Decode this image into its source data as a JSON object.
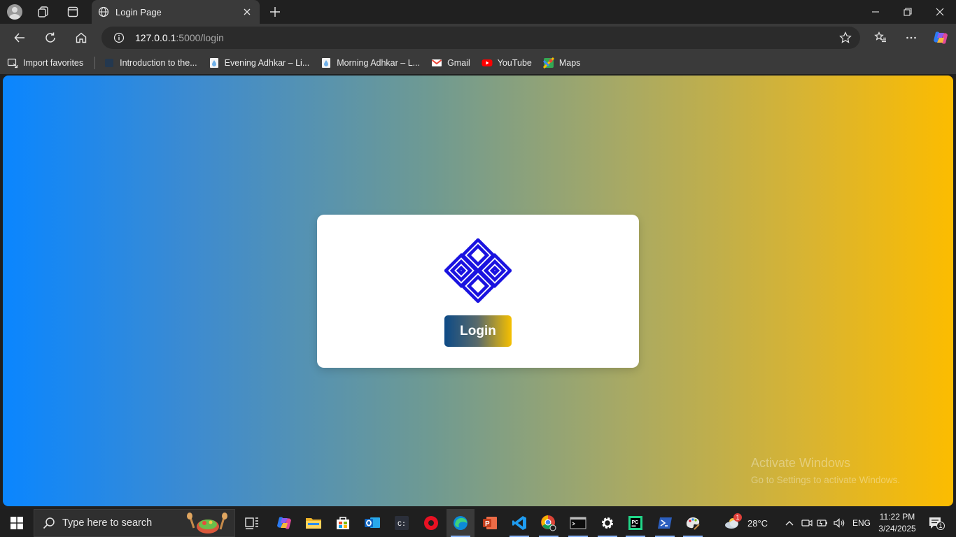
{
  "browser": {
    "tab": {
      "title": "Login Page"
    },
    "address": {
      "host": "127.0.0.1",
      "rest": ":5000/login"
    },
    "favorites": [
      {
        "label": "Import favorites",
        "icon": "import-icon"
      },
      {
        "label": "Introduction to the...",
        "icon": "page-icon"
      },
      {
        "label": "Evening Adhkar – Li...",
        "icon": "drop-icon"
      },
      {
        "label": "Morning Adhkar – L...",
        "icon": "drop-icon"
      },
      {
        "label": "Gmail",
        "icon": "gmail-icon"
      },
      {
        "label": "YouTube",
        "icon": "youtube-icon"
      },
      {
        "label": "Maps",
        "icon": "maps-icon"
      }
    ]
  },
  "page": {
    "login_label": "Login",
    "logo_color": "#1a12e0",
    "gradient": [
      "#0a86ff",
      "#fcbc00"
    ]
  },
  "watermark": {
    "title": "Activate Windows",
    "subtitle": "Go to Settings to activate Windows."
  },
  "taskbar": {
    "search_placeholder": "Type here to search",
    "weather": "28°C",
    "weather_badge": "1",
    "language": "ENG",
    "time": "11:22 PM",
    "date": "3/24/2025",
    "notifications": "1"
  }
}
